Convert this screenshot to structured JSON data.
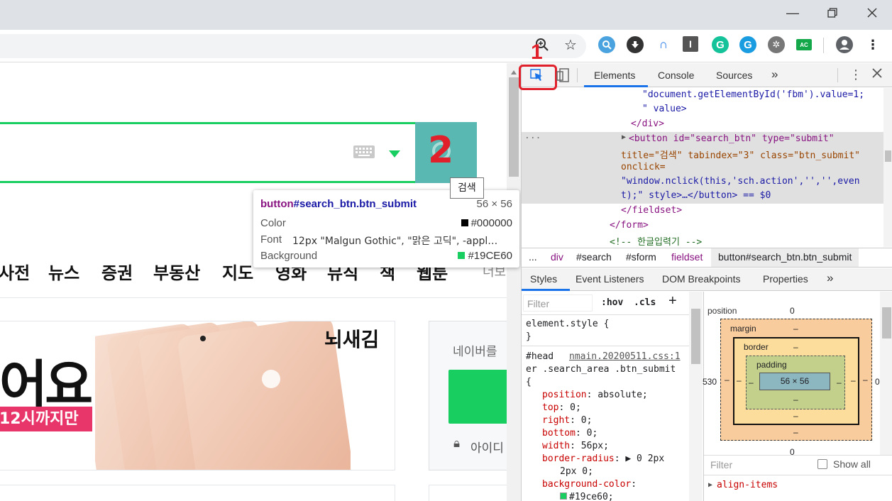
{
  "window": {
    "minimize_icon": "minimize-icon",
    "maximize_icon": "restore-icon",
    "close_icon": "close-icon"
  },
  "toolbar": {
    "zoom_icon": "zoom-icon",
    "star_icon": "bookmark-star-icon",
    "extensions": [
      "search-ext-icon",
      "download-ext-icon",
      "headphones-ext-icon",
      "text-ext-icon",
      "grammarly-icon",
      "grammarly-g-icon",
      "film-reel-icon",
      "ac-ext-icon"
    ],
    "ac_label": "AC",
    "profile_icon": "profile-icon",
    "menu_icon": "kebab-menu-icon"
  },
  "page": {
    "nav_items": [
      "사전",
      "뉴스",
      "증권",
      "부동산",
      "지도",
      "영화",
      "뮤직",
      "책",
      "웹툰",
      "더보"
    ],
    "banner_headline": "어요",
    "banner_brand": "뇌새김",
    "banner_promo": "12시까지만",
    "login_text": "네이버를",
    "login_id_label": "아이디",
    "annotation_2": "2",
    "annotation_1": "1"
  },
  "tooltip": {
    "selector_tag": "button",
    "selector_rest": "#search_btn.btn_submit",
    "size": "56 × 56",
    "rows": [
      {
        "label": "Color",
        "value": "#000000",
        "swatch": "#000000"
      },
      {
        "label": "Font",
        "value": "12px \"Malgun Gothic\", \"맑은 고딕\", -appl…",
        "swatch": ""
      },
      {
        "label": "Background",
        "value": "#19CE60",
        "swatch": "#19ce60"
      }
    ],
    "title_tip": "검색"
  },
  "devtools": {
    "tabs": [
      "Elements",
      "Console",
      "Sources"
    ],
    "more_tabs": "»",
    "dom_lines": [
      "\"document.getElementById('fbm').value=1;",
      "\" value>",
      "</div>",
      "<button id=\"search_btn\" type=\"submit\"",
      "title=\"검색\" tabindex=\"3\" class=\"btn_submit\"",
      "onclick=",
      "\"window.nclick(this,'sch.action','','',even",
      "t);\" style>…</button> == $0",
      "</fieldset>",
      "</form>",
      "<!-- 한글입력기 -->"
    ],
    "breadcrumbs": [
      "...",
      "div",
      "#search",
      "#sform",
      "fieldset",
      "button#search_btn.btn_submit"
    ],
    "styles_tabs": [
      "Styles",
      "Event Listeners",
      "DOM Breakpoints",
      "Properties",
      "»"
    ],
    "filter_placeholder": "Filter",
    "hov": ":hov",
    "cls": ".cls",
    "plus": "+",
    "element_style": "element.style {",
    "element_style_close": "}",
    "rule_selector_1": "#head",
    "rule_source": "nmain.20200511.css:1",
    "rule_selector_2": "er .search_area .btn_submit",
    "rule_open": "{",
    "declarations": [
      {
        "prop": "position",
        "value": "absolute;"
      },
      {
        "prop": "top",
        "value": "0;"
      },
      {
        "prop": "right",
        "value": "0;"
      },
      {
        "prop": "bottom",
        "value": "0;"
      },
      {
        "prop": "width",
        "value": "56px;"
      },
      {
        "prop": "border-radius",
        "value": "▶ 0 2px"
      },
      {
        "prop": "",
        "value": "2px 0;"
      },
      {
        "prop": "background-color",
        "value": ""
      },
      {
        "prop": "",
        "value": "#19ce60;"
      }
    ],
    "boxmodel": {
      "position_label": "position",
      "position_value": "0",
      "margin_label": "margin",
      "margin_value": "–",
      "border_label": "border",
      "border_value": "–",
      "padding_label": "padding",
      "padding_value": "–",
      "content": "56 × 56",
      "left_value": "530",
      "right_value": "0",
      "bottom_value": "0",
      "dash": "–"
    },
    "computed_filter": "Filter",
    "show_all": "Show all",
    "computed_first": "align-items"
  }
}
